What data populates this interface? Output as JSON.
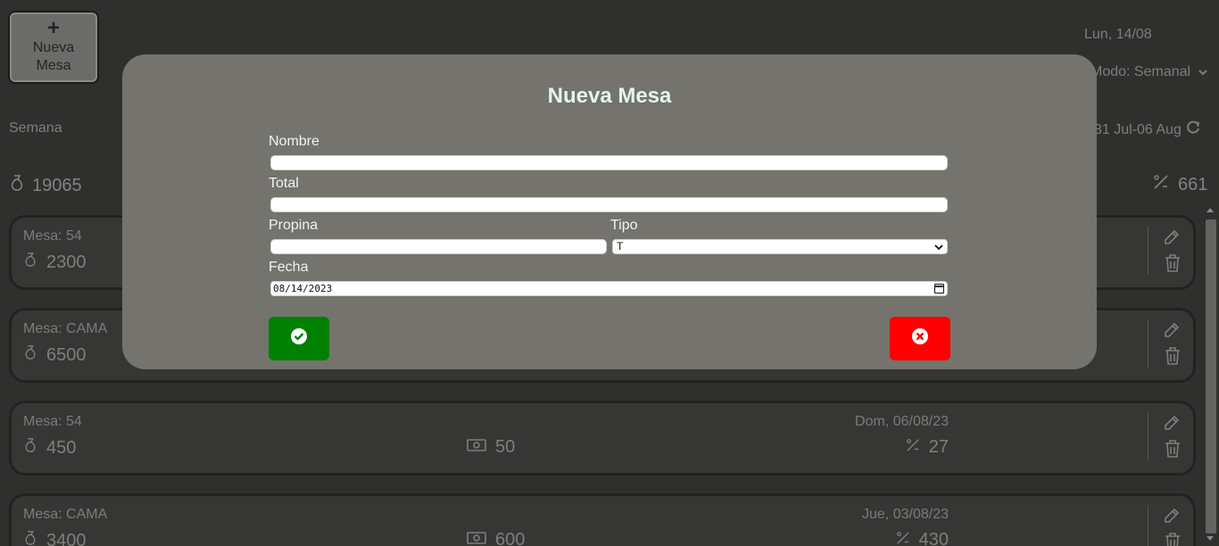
{
  "header": {
    "new_button_label_line1": "Nueva",
    "new_button_label_line2": "Mesa",
    "new_button_plus": "+",
    "current_date": "Lun, 14/08",
    "mode_label": "Modo:",
    "mode_value": "Semanal",
    "period_label": "Semana",
    "period_range": "31 Jul-06 Aug",
    "total_amount": "19065",
    "total_percent": "661"
  },
  "cards": [
    {
      "mesa": "Mesa: 54",
      "amount": "2300",
      "tip": "",
      "date": "",
      "percent": ""
    },
    {
      "mesa": "Mesa: CAMA",
      "amount": "6500",
      "tip": "",
      "date": "",
      "percent": ""
    },
    {
      "mesa": "Mesa: 54",
      "amount": "450",
      "tip": "50",
      "date": "Dom, 06/08/23",
      "percent": "27"
    },
    {
      "mesa": "Mesa: CAMA",
      "amount": "3400",
      "tip": "600",
      "date": "Jue, 03/08/23",
      "percent": "430"
    }
  ],
  "modal": {
    "title": "Nueva Mesa",
    "fields": {
      "nombre_label": "Nombre",
      "nombre_value": "",
      "total_label": "Total",
      "total_value": "",
      "propina_label": "Propina",
      "propina_value": "",
      "tipo_label": "Tipo",
      "tipo_value": "T",
      "fecha_label": "Fecha",
      "fecha_value": "08/14/2023"
    },
    "confirm_icon": "check-circle-icon",
    "cancel_icon": "x-circle-icon"
  },
  "colors": {
    "confirm": "#008000",
    "cancel": "#ff0000",
    "modal_bg": "#74736e",
    "title": "#e4f5ec"
  }
}
